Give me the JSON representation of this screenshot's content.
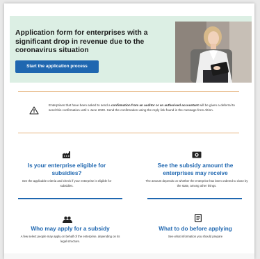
{
  "hero": {
    "title": "Application form for enterprises with a significant drop in revenue due to the coronavirus situation",
    "button_label": "Start the application process"
  },
  "notice": {
    "icon": "warning-icon",
    "text_before": "Enterprises that have been asked to send a ",
    "text_bold": "confirmation from an auditor or an authorised accountant",
    "text_after": " will be given a deferral to send this confirmation until 1 June 2020. Send the confirmation using the reply link found in the message from Altinn."
  },
  "cards": [
    {
      "icon": "factory-icon",
      "title": "Is your enterprise eligible for subsidies?",
      "description": "See the applicable criteria and check if your enterprise is eligible for subsidies."
    },
    {
      "icon": "money-icon",
      "title": "See the subsidy amount the enterprises may receive",
      "description": "The amount depends on whether the enterprise has been ordered to close by the state, among other things."
    },
    {
      "icon": "people-icon",
      "title": "Who may apply for a subsidy",
      "description": "A few select people may apply on behalf of the enterprise, depending on its legal structure."
    },
    {
      "icon": "checklist-icon",
      "title": "What to do before applying",
      "description": "See what information you should prepare"
    }
  ],
  "colors": {
    "hero_background": "#dcefe4",
    "accent_blue": "#1f67b0",
    "divider_orange": "#e5b27b"
  }
}
